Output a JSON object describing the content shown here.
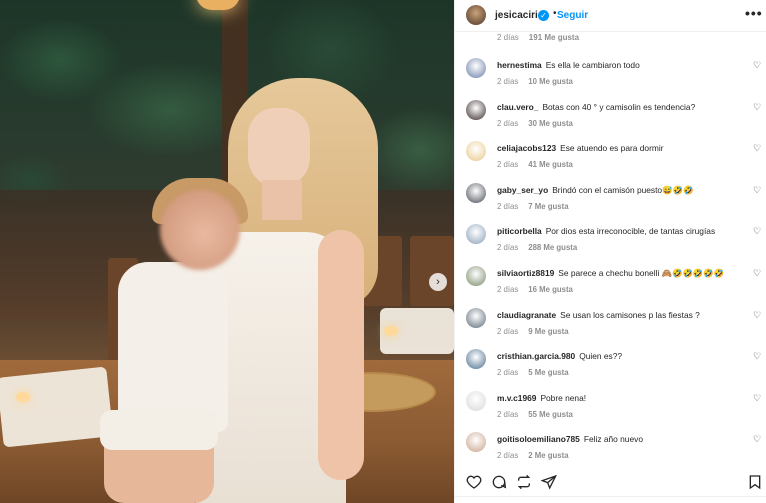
{
  "header": {
    "username": "jesicacirio",
    "separator": "•",
    "follow_label": "Seguir",
    "more_label": "•••"
  },
  "photo": {
    "next_label": "›"
  },
  "top_meta": {
    "time": "2 días",
    "likes": "191 Me gusta"
  },
  "comments": [
    {
      "user": "hernestima",
      "text": "Es ella le cambiaron todo",
      "time": "2 días",
      "likes": "10 Me gusta",
      "avatar_color": "#6b7fa8"
    },
    {
      "user": "clau.vero_",
      "text": "Botas con 40 ° y camisolin es tendencia?",
      "time": "2 días",
      "likes": "30 Me gusta",
      "avatar_color": "#3a2b2b"
    },
    {
      "user": "celiajacobs123",
      "text": "Ese atuendo es para dormir",
      "time": "2 días",
      "likes": "41 Me gusta",
      "avatar_color": "#e8c98a"
    },
    {
      "user": "gaby_ser_yo",
      "text": "Brindó con el camisón puesto😅🤣🤣",
      "time": "2 días",
      "likes": "7 Me gusta",
      "avatar_color": "#4a4f5a"
    },
    {
      "user": "piticorbella",
      "text": "Por dios esta irreconocible, de tantas cirugías",
      "time": "2 días",
      "likes": "288 Me gusta",
      "avatar_color": "#8aa0b8"
    },
    {
      "user": "silviaortiz8819",
      "text": "Se parece a chechu bonelli 🙈🤣🤣🤣🤣🤣",
      "time": "2 días",
      "likes": "16 Me gusta",
      "avatar_color": "#7a8a6a"
    },
    {
      "user": "claudiagranate",
      "text": "Se usan los camisones p las fiestas ?",
      "time": "2 días",
      "likes": "9 Me gusta",
      "avatar_color": "#5b6b78"
    },
    {
      "user": "cristhian.garcia.980",
      "text": "Quien es??",
      "time": "2 días",
      "likes": "5 Me gusta",
      "avatar_color": "#4b6f8f"
    },
    {
      "user": "m.v.c1969",
      "text": "Pobre nena!",
      "time": "2 días",
      "likes": "55 Me gusta",
      "avatar_color": "#d8d8d8"
    },
    {
      "user": "goitisoloemiliano785",
      "text": "Feliz año nuevo",
      "time": "2 días",
      "likes": "2 Me gusta",
      "avatar_color": "#c9a48a"
    }
  ],
  "actions": {
    "like_icon": "heart-outline-icon",
    "comment_icon": "comment-bubble-icon",
    "share_icon": "repost-icon",
    "send_icon": "paper-plane-icon",
    "save_icon": "bookmark-icon"
  }
}
